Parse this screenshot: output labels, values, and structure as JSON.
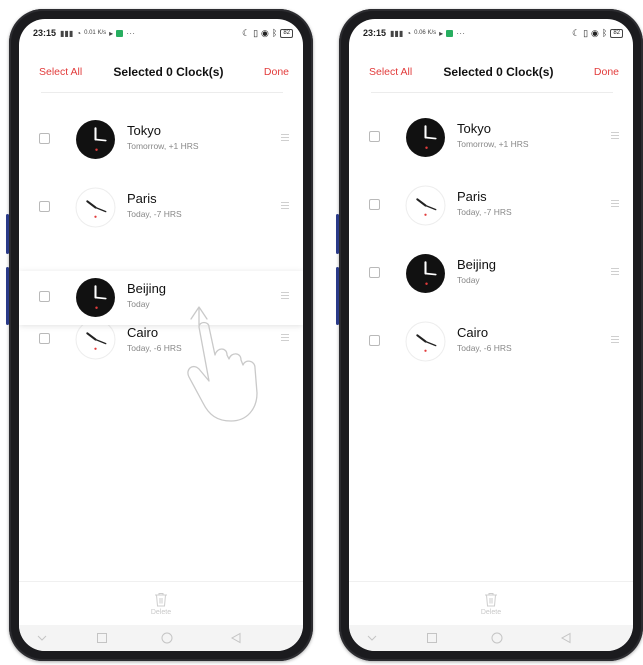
{
  "screens": [
    {
      "status": {
        "time": "23:15",
        "net_speed": "0.01 K/s",
        "battery": "82"
      },
      "header": {
        "select_all": "Select All",
        "title": "Selected 0 Clock(s)",
        "done": "Done"
      },
      "clocks": [
        {
          "city": "Tokyo",
          "offset": "Tomorrow, +1 HRS",
          "theme": "dark"
        },
        {
          "city": "Paris",
          "offset": "Today, -7 HRS",
          "theme": "light"
        },
        {
          "city": "Beijing",
          "offset": "Today",
          "theme": "dark"
        },
        {
          "city": "Cairo",
          "offset": "Today, -6 HRS",
          "theme": "light"
        }
      ],
      "footer": {
        "delete_label": "Delete"
      }
    },
    {
      "status": {
        "time": "23:15",
        "net_speed": "0.06 K/s",
        "battery": "82"
      },
      "header": {
        "select_all": "Select All",
        "title": "Selected 0 Clock(s)",
        "done": "Done"
      },
      "clocks": [
        {
          "city": "Tokyo",
          "offset": "Tomorrow, +1 HRS",
          "theme": "dark"
        },
        {
          "city": "Paris",
          "offset": "Today, -7 HRS",
          "theme": "light"
        },
        {
          "city": "Beijing",
          "offset": "Today",
          "theme": "dark"
        },
        {
          "city": "Cairo",
          "offset": "Today, -6 HRS",
          "theme": "light"
        }
      ],
      "footer": {
        "delete_label": "Delete"
      }
    }
  ],
  "colors": {
    "accent": "#e23b3b",
    "dark_clock": "#111111",
    "second_hand": "#e23b3b"
  },
  "icons": [
    "signal-icon",
    "wifi-icon",
    "play-icon",
    "moon-icon",
    "vibrate-icon",
    "alarm-icon",
    "bluetooth-icon",
    "battery-icon",
    "drag-handle-icon",
    "trash-icon",
    "back-chevron-icon",
    "recents-icon",
    "home-icon",
    "triangle-back-icon",
    "swipe-hand-icon"
  ]
}
